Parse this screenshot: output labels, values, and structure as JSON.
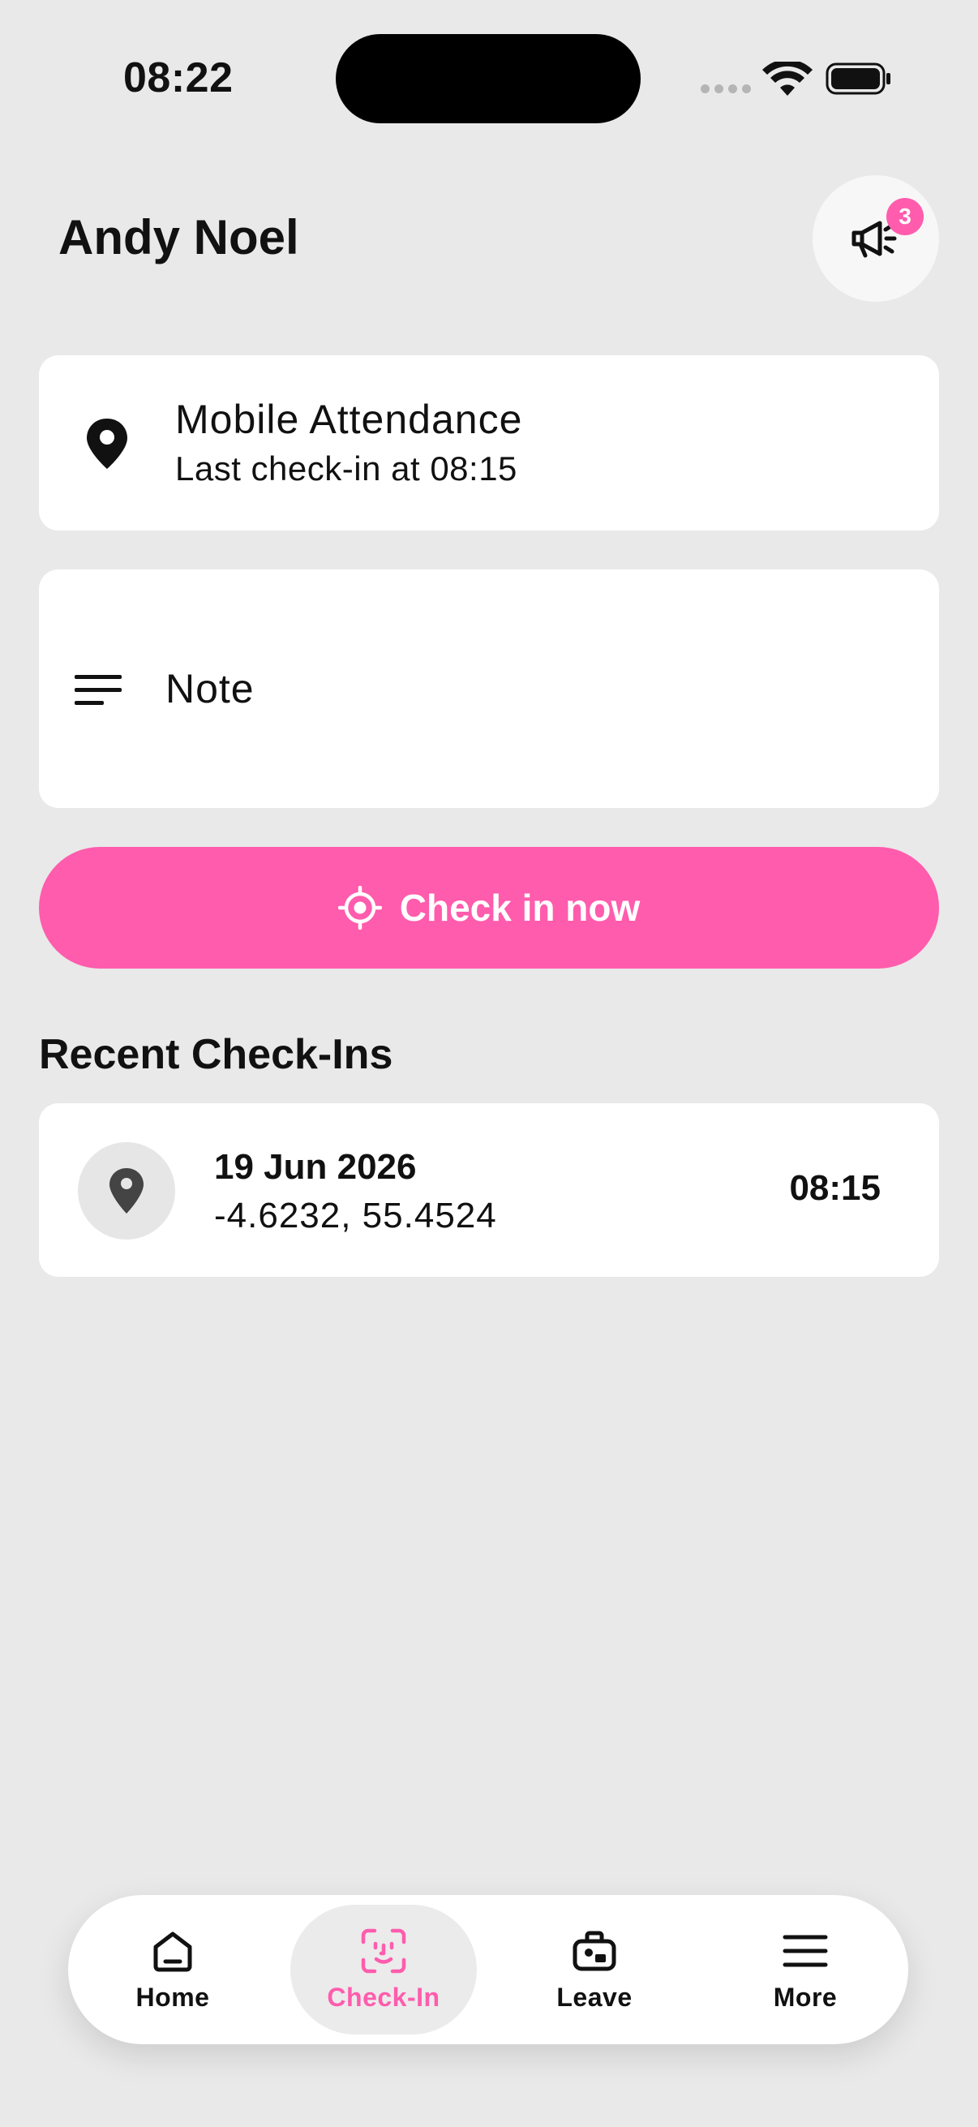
{
  "status_bar": {
    "time": "08:22"
  },
  "header": {
    "user_name": "Andy Noel",
    "notification_count": "3"
  },
  "attendance": {
    "title": "Mobile Attendance",
    "subtitle": "Last check-in at 08:15"
  },
  "note": {
    "label": "Note"
  },
  "check_in_button": {
    "label": "Check in now"
  },
  "recent": {
    "title": "Recent Check-Ins",
    "items": [
      {
        "date": "19 Jun 2026",
        "coords": "-4.6232, 55.4524",
        "time": "08:15"
      }
    ]
  },
  "bottom_nav": {
    "items": [
      {
        "label": "Home",
        "icon": "home-icon"
      },
      {
        "label": "Check-In",
        "icon": "face-scan-icon",
        "active": true
      },
      {
        "label": "Leave",
        "icon": "briefcase-icon"
      },
      {
        "label": "More",
        "icon": "menu-icon"
      }
    ]
  },
  "colors": {
    "accent": "#ff5cad",
    "background": "#e9e9e9",
    "card": "#ffffff"
  }
}
